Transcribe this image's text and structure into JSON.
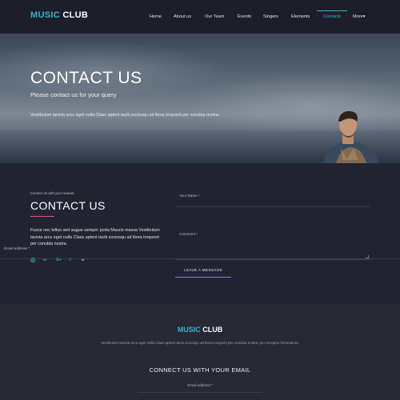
{
  "brand": {
    "part1": "MUSIC",
    "part2": "CLUB"
  },
  "nav": {
    "items": [
      {
        "label": "Home"
      },
      {
        "label": "About us"
      },
      {
        "label": "Our Team"
      },
      {
        "label": "Events"
      },
      {
        "label": "Singers"
      },
      {
        "label": "Elements"
      },
      {
        "label": "Contacts",
        "active": true
      },
      {
        "label": "More▾"
      }
    ]
  },
  "hero": {
    "title": "CONTACT US",
    "subtitle": "Please contact us for your query",
    "description": "Vestibulum lacinia arcu eget nulla.Class aptent taciti sociosqu ad litora torquent per conubia nostra."
  },
  "contact": {
    "eyebrow": "Connect us with your reviews",
    "title": "CONTACT US",
    "text": "Fusce nec tellus sed augue semper porta Mauris massa Vestibulum lacinia arcu eget nulla Class aptent taciti sociosqu ad litora torquent per conubia nostra.",
    "socials": [
      "instagram-icon",
      "linkedin-icon",
      "google-plus-icon",
      "facebook-icon",
      "twitter-icon"
    ],
    "form": {
      "name_placeholder": "Your Name *",
      "email_placeholder": "Email address *",
      "comment_placeholder": "Comment *",
      "submit_label": "LEAVE A MESSAGE"
    }
  },
  "footer": {
    "brand": {
      "part1": "MUSIC",
      "part2": "CLUB"
    },
    "description": "Vestibulum lacinia arcu eget nulla Class aptent taciti sociosqu ad litora torquent per conubia nostra, per inceptos himenaeos.",
    "heading": "CONNECT US WITH YOUR EMAIL",
    "email_placeholder": "Email address *"
  },
  "colors": {
    "accent": "#2fb6c9",
    "underline": "#e2558a",
    "button_line": "#8c7be0"
  }
}
